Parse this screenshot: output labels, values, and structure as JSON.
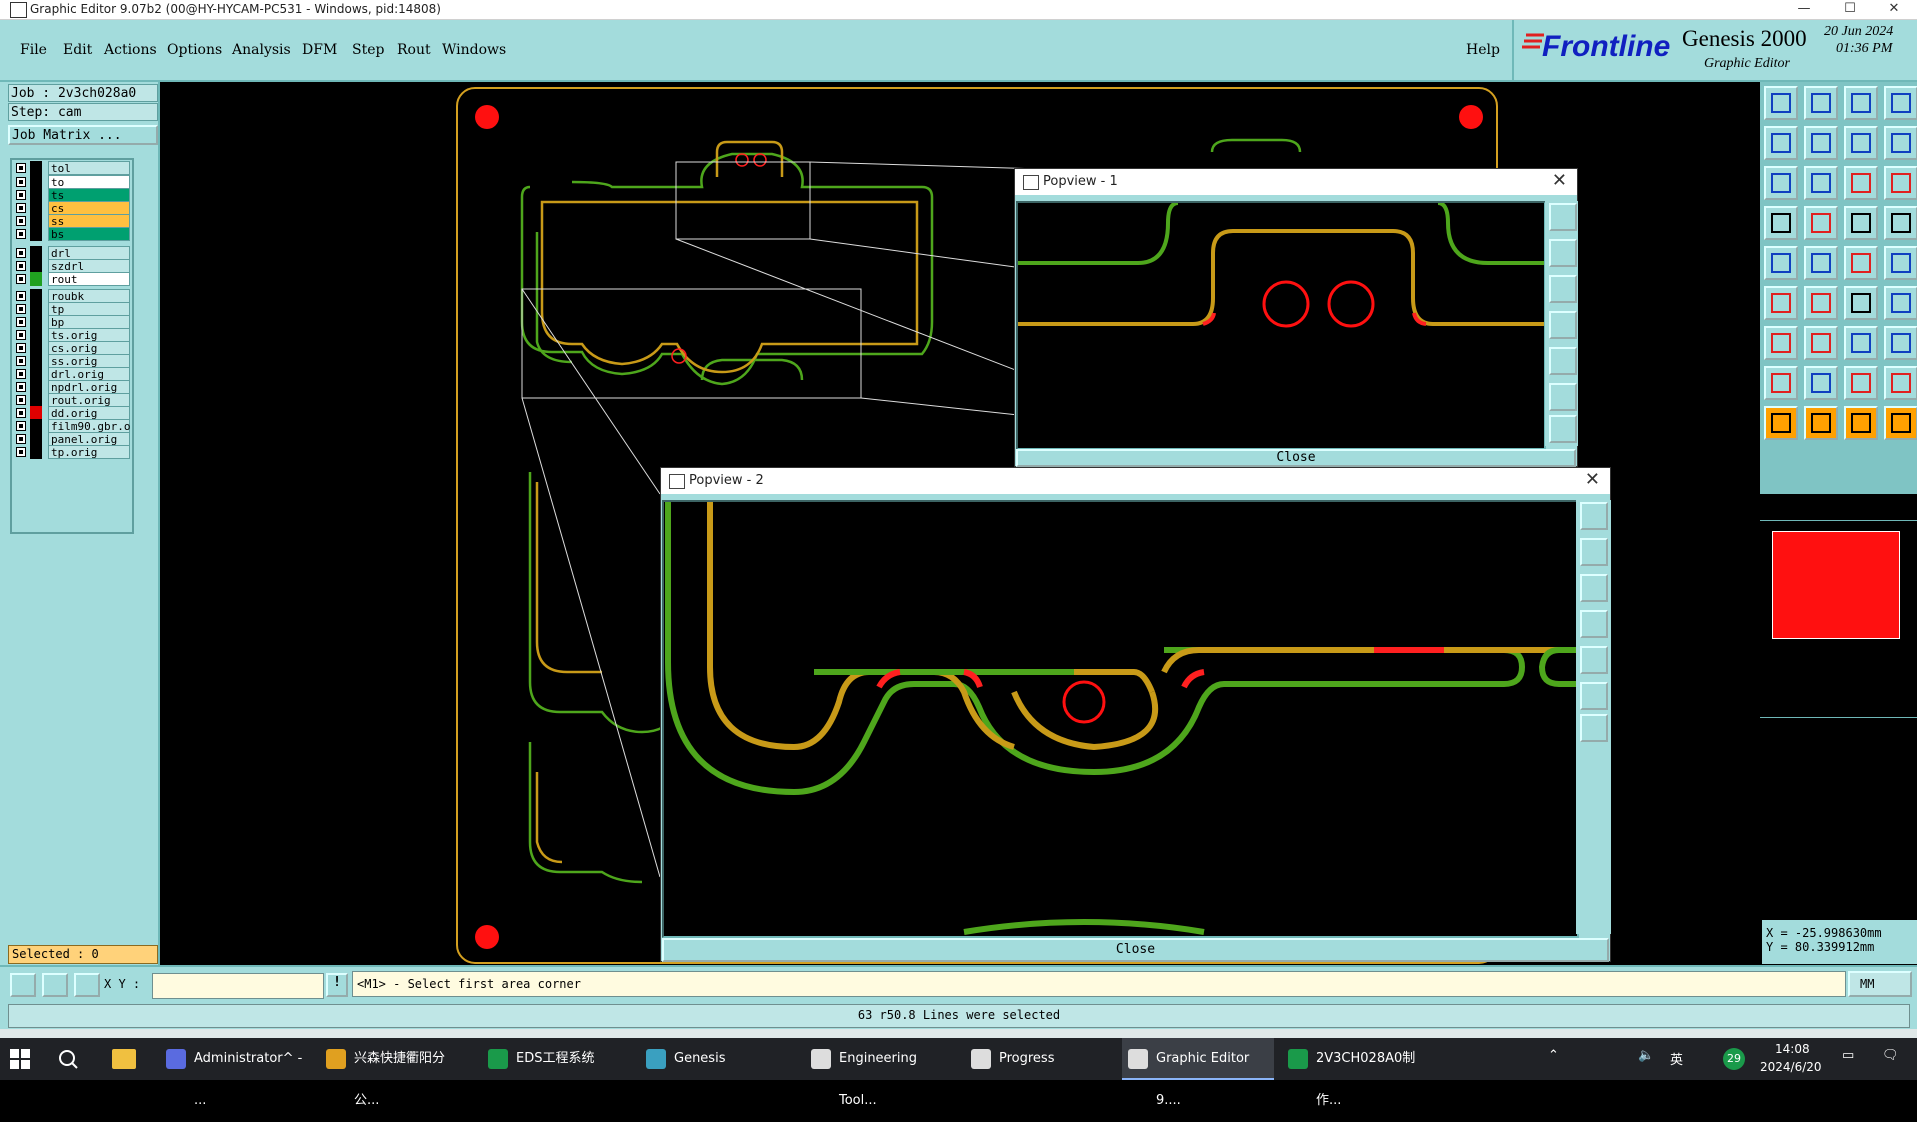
{
  "window": {
    "title": "Graphic Editor 9.07b2 (00@HY-HYCAM-PC531 - Windows, pid:14808)",
    "min": "—",
    "max": "☐",
    "close": "✕"
  },
  "menu": {
    "items": [
      "File",
      "Edit",
      "Actions",
      "Options",
      "Analysis",
      "DFM",
      "Step",
      "Rout",
      "Windows"
    ],
    "help": "Help"
  },
  "brand": {
    "logo": "Frontline",
    "product": "Genesis 2000",
    "subtitle": "Graphic Editor",
    "date": "20 Jun 2024",
    "time": "01:36 PM"
  },
  "job": {
    "job_label": "Job : 2v3ch028a0",
    "step_label": "Step: cam",
    "matrix_button": "Job Matrix ..."
  },
  "layers": [
    {
      "name": "tol",
      "color": "#bfe6e6",
      "swatch": "#000"
    },
    {
      "name": "to",
      "color": "#ffffff",
      "swatch": "#000"
    },
    {
      "name": "ts",
      "color": "#00a070",
      "swatch": "#000"
    },
    {
      "name": "cs",
      "color": "#ffc040",
      "swatch": "#000"
    },
    {
      "name": "ss",
      "color": "#ffc040",
      "swatch": "#000"
    },
    {
      "name": "bs",
      "color": "#00a070",
      "swatch": "#000"
    },
    {
      "name": "drl",
      "color": "#bfe6e6",
      "swatch": "#000"
    },
    {
      "name": "szdrl",
      "color": "#bfe6e6",
      "swatch": "#000"
    },
    {
      "name": "rout",
      "color": "#ffffff",
      "swatch": "#20a020"
    },
    {
      "name": "roubk",
      "color": "#bfe6e6",
      "swatch": "#000"
    },
    {
      "name": "tp",
      "color": "#bfe6e6",
      "swatch": "#000"
    },
    {
      "name": "bp",
      "color": "#bfe6e6",
      "swatch": "#000"
    },
    {
      "name": "ts.orig",
      "color": "#bfe6e6",
      "swatch": "#000"
    },
    {
      "name": "cs.orig",
      "color": "#bfe6e6",
      "swatch": "#000"
    },
    {
      "name": "ss.orig",
      "color": "#bfe6e6",
      "swatch": "#000"
    },
    {
      "name": "drl.orig",
      "color": "#bfe6e6",
      "swatch": "#000"
    },
    {
      "name": "npdrl.orig",
      "color": "#bfe6e6",
      "swatch": "#000"
    },
    {
      "name": "rout.orig",
      "color": "#bfe6e6",
      "swatch": "#000"
    },
    {
      "name": "dd.orig",
      "color": "#bfe6e6",
      "swatch": "#e00000"
    },
    {
      "name": "film90.gbr.o",
      "color": "#bfe6e6",
      "swatch": "#000"
    },
    {
      "name": "panel.orig",
      "color": "#bfe6e6",
      "swatch": "#000"
    },
    {
      "name": "tp.orig",
      "color": "#bfe6e6",
      "swatch": "#000"
    }
  ],
  "selected": "Selected : 0",
  "popview1": {
    "title": "Popview - 1",
    "close_label": "Close"
  },
  "popview2": {
    "title": "Popview - 2",
    "close_label": "Close"
  },
  "coords": {
    "x": "X = -25.998630mm",
    "y": "Y = 80.339912mm"
  },
  "input": {
    "xy_label": "X Y :",
    "xy_value": "",
    "prompt": "<M1> - Select first area corner",
    "units": "MM"
  },
  "message": "63 r50.8 Lines were selected",
  "taskbar": {
    "items": [
      {
        "label": "Administrator^ - ...",
        "color": "#5a6be0"
      },
      {
        "label": "兴森快捷衢阳分公...",
        "color": "#e0a020"
      },
      {
        "label": "EDS工程系统",
        "color": "#1a9a4a"
      },
      {
        "label": "Genesis",
        "color": "#3aa0c0"
      },
      {
        "label": "Engineering Tool...",
        "color": "#dddddd"
      },
      {
        "label": "Progress",
        "color": "#dddddd"
      },
      {
        "label": "Graphic Editor 9....",
        "color": "#dddddd"
      },
      {
        "label": "2V3CH028A0制作...",
        "color": "#1a9a4a"
      }
    ],
    "tray_time": "14:08",
    "tray_date": "2024/6/20",
    "tray_lang": "英",
    "tray_badge": "29"
  }
}
